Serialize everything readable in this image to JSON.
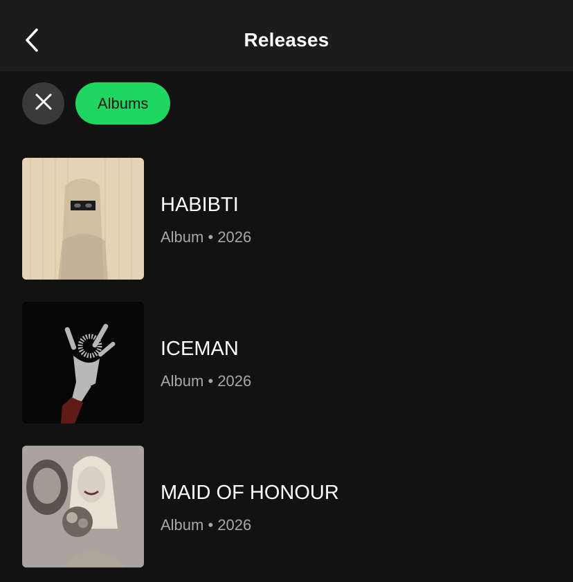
{
  "header": {
    "title": "Releases",
    "back_icon": "chevron-left-icon"
  },
  "filters": {
    "clear_icon": "close-icon",
    "active_chip": "Albums",
    "chip_color": "#1ed760"
  },
  "releases": [
    {
      "title": "HABIBTI",
      "type": "Album",
      "separator": "•",
      "year": "2026"
    },
    {
      "title": "ICEMAN",
      "type": "Album",
      "separator": "•",
      "year": "2026"
    },
    {
      "title": "MAID OF HONOUR",
      "type": "Album",
      "separator": "•",
      "year": "2026"
    }
  ],
  "colors": {
    "background": "#121212",
    "header_bg": "#1c1c1c",
    "subtitle": "#a7a7a7"
  }
}
